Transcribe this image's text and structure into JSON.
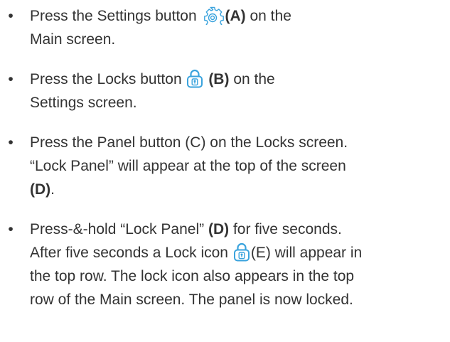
{
  "icon_color": "#3aa3dd",
  "text_color": "#333333",
  "steps": [
    {
      "bullet": "•",
      "t1": "Press the Settings button",
      "icon": "gear-icon",
      "t2": "(A)",
      "t3": "on the",
      "t4": "Main screen."
    },
    {
      "bullet": "•",
      "t1": "Press the Locks button",
      "icon": "lock-icon",
      "t2": "(B)",
      "t3": "on the",
      "t4": "Settings screen."
    },
    {
      "bullet": "•",
      "t1": "Press the Panel button (C) on the Locks screen.",
      "t2": "“Lock Panel” will appear at the top of the screen",
      "t3": "(D)",
      "t4": "."
    },
    {
      "bullet": "•",
      "t1": "Press-&-hold “Lock Panel”",
      "t2": "(D)",
      "t3": "for five seconds.",
      "t4": "After five seconds a Lock icon",
      "icon": "lock-icon",
      "t5": "(E) will appear in",
      "t6": "the top row. The lock icon also appears in the top",
      "t7": "row of the Main screen. The panel is now locked."
    }
  ]
}
